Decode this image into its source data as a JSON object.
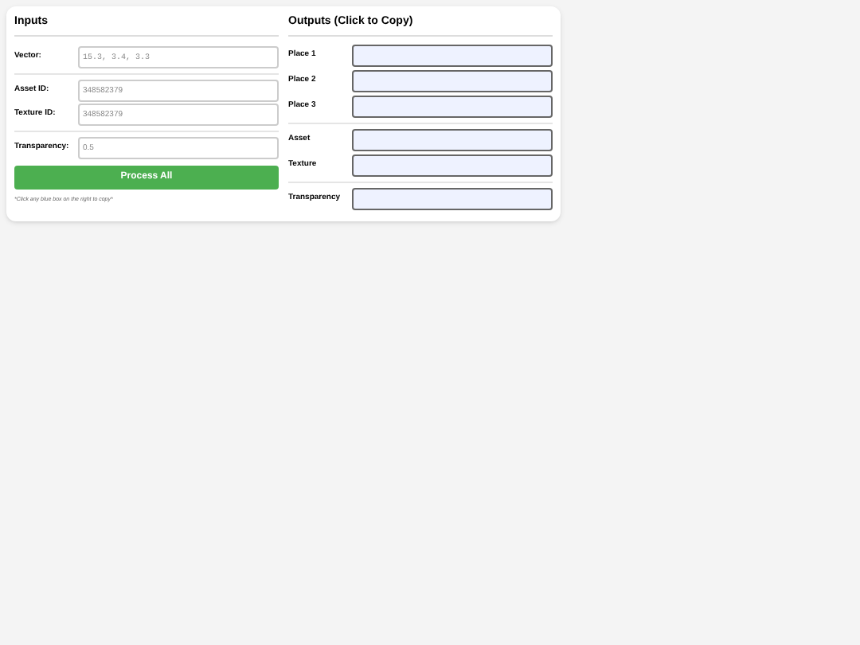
{
  "inputs": {
    "title": "Inputs",
    "groups": [
      [
        {
          "label": "Vector:",
          "placeholder": "15.3, 3.4, 3.3",
          "kind": "mono"
        }
      ],
      [
        {
          "label": "Asset ID:",
          "placeholder": "348582379",
          "kind": "text"
        },
        {
          "label": "Texture ID:",
          "placeholder": "348582379",
          "kind": "text"
        }
      ],
      [
        {
          "label": "Transparency:",
          "placeholder": "0.5",
          "kind": "text"
        }
      ]
    ],
    "button": "Process All",
    "note": "*Click any blue box on the right to copy*"
  },
  "outputs": {
    "title": "Outputs (Click to Copy)",
    "groups": [
      [
        {
          "label": "Place 1"
        },
        {
          "label": "Place 2"
        },
        {
          "label": "Place 3"
        }
      ],
      [
        {
          "label": "Asset"
        },
        {
          "label": "Texture"
        }
      ],
      [
        {
          "label": "Transparency"
        }
      ]
    ]
  }
}
